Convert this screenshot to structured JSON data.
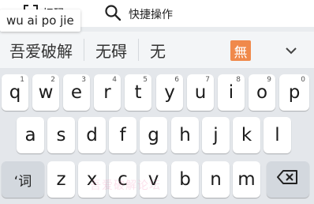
{
  "toolbar": {
    "scan_label": "扫码",
    "quick_ops_label": "快捷操作"
  },
  "composition": {
    "text": "wu ai po jie"
  },
  "candidates": {
    "items": [
      "吾爱破解",
      "无碍",
      "无"
    ],
    "emoji_label": "無"
  },
  "keyboard": {
    "row1": [
      {
        "letter": "q",
        "num": "1"
      },
      {
        "letter": "w",
        "num": "2"
      },
      {
        "letter": "e",
        "num": "3"
      },
      {
        "letter": "r",
        "num": "4"
      },
      {
        "letter": "t",
        "num": "5"
      },
      {
        "letter": "y",
        "num": "6"
      },
      {
        "letter": "u",
        "num": "7"
      },
      {
        "letter": "i",
        "num": "8"
      },
      {
        "letter": "o",
        "num": "9"
      },
      {
        "letter": "p",
        "num": "0"
      }
    ],
    "row2": [
      "a",
      "s",
      "d",
      "f",
      "g",
      "h",
      "j",
      "k",
      "l"
    ],
    "row3": [
      "z",
      "x",
      "c",
      "v",
      "b",
      "n",
      "m"
    ],
    "lang_key": "‘词"
  },
  "watermark": "吾爱破解论坛",
  "colors": {
    "emoji_button": "#f0894b",
    "keyboard_bg": "#e4e7eb",
    "function_key": "#d3d8de"
  }
}
